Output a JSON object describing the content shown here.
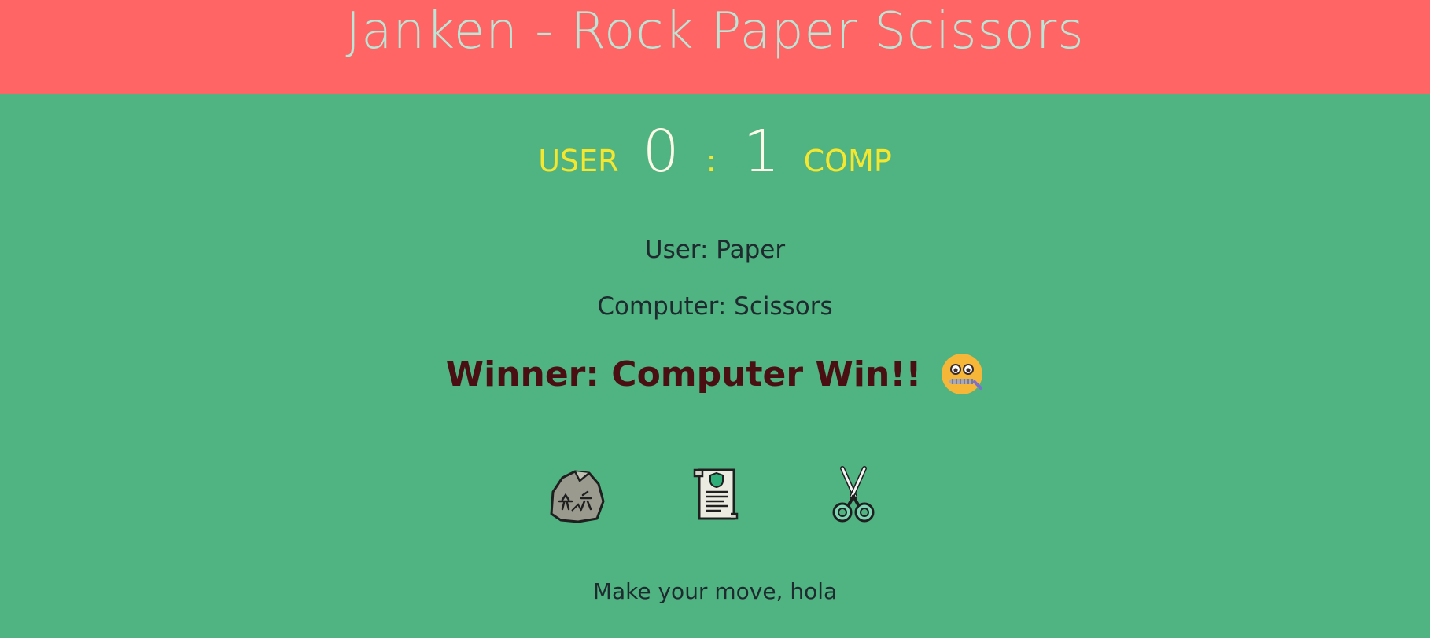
{
  "header": {
    "title": "Janken - Rock Paper Scissors"
  },
  "scoreboard": {
    "user_label": "USER",
    "user_score": "0",
    "separator": ":",
    "comp_score": "1",
    "comp_label": "COMP"
  },
  "result": {
    "user_choice": "User: Paper",
    "computer_choice": "Computer: Scissors",
    "winner": "Winner: Computer Win!!",
    "winner_emoji": "zipper-mouth-face-icon"
  },
  "choices": [
    {
      "name": "rock",
      "icon": "rock-icon"
    },
    {
      "name": "paper",
      "icon": "paper-scroll-icon"
    },
    {
      "name": "scissors",
      "icon": "scissors-icon"
    }
  ],
  "prompt": "Make your move, hola",
  "colors": {
    "header_bg": "#ff6565",
    "page_bg": "#4fb482",
    "title": "#b9e6d6",
    "score_label": "#f5e72f",
    "score_num": "#fdfbe8",
    "winner": "#4a0f12"
  }
}
